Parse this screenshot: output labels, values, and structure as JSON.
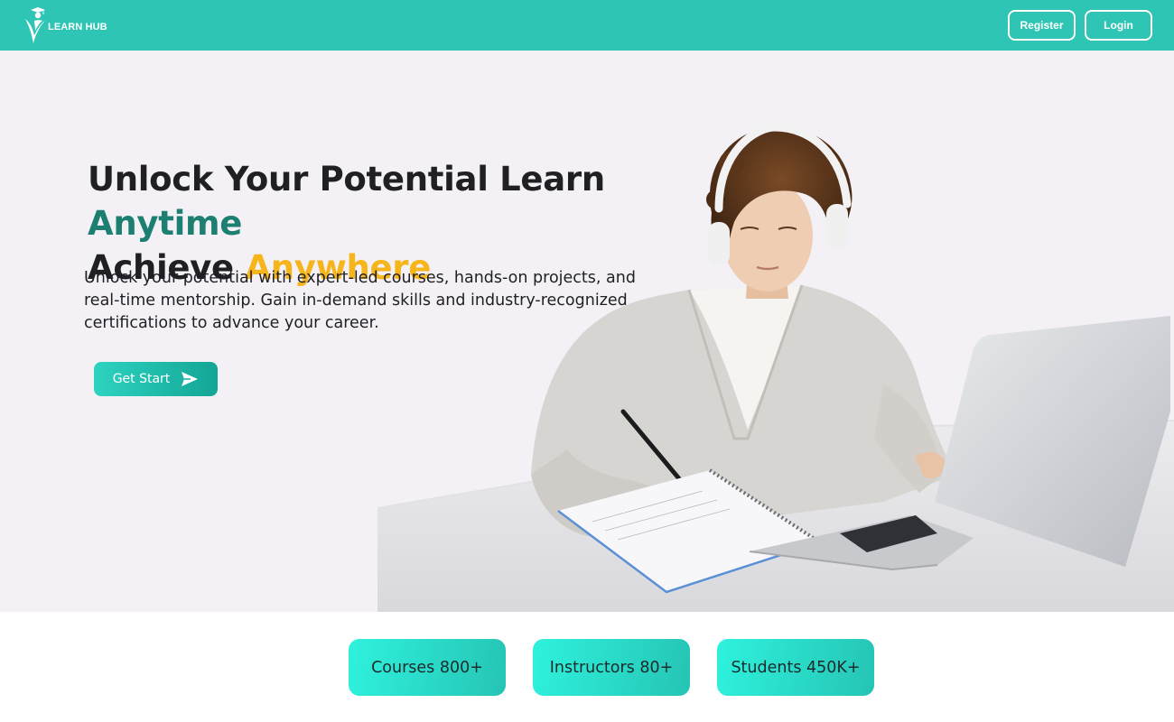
{
  "brand": {
    "name": "LEARN HUB",
    "color": "#2ec5b4"
  },
  "nav": {
    "register_label": "Register",
    "login_label": "Login"
  },
  "hero": {
    "headline_part1": "Unlock Your Potential Learn ",
    "headline_accent1": "Anytime",
    "headline_part2": "Achieve ",
    "headline_accent2": "Anywhere",
    "description": "Unlock your potential with expert-led courses, hands-on projects, and real-time mentorship. Gain in-demand skills and industry-recognized certifications to advance your career.",
    "cta_label": "Get Start",
    "cta_icon": "send-arrow-icon",
    "accent_teal": "#1d7f72",
    "accent_gold": "#f6b51b"
  },
  "stats": [
    {
      "label": "Courses 800+"
    },
    {
      "label": "Instructors 80+"
    },
    {
      "label": "Students 450K+"
    }
  ]
}
